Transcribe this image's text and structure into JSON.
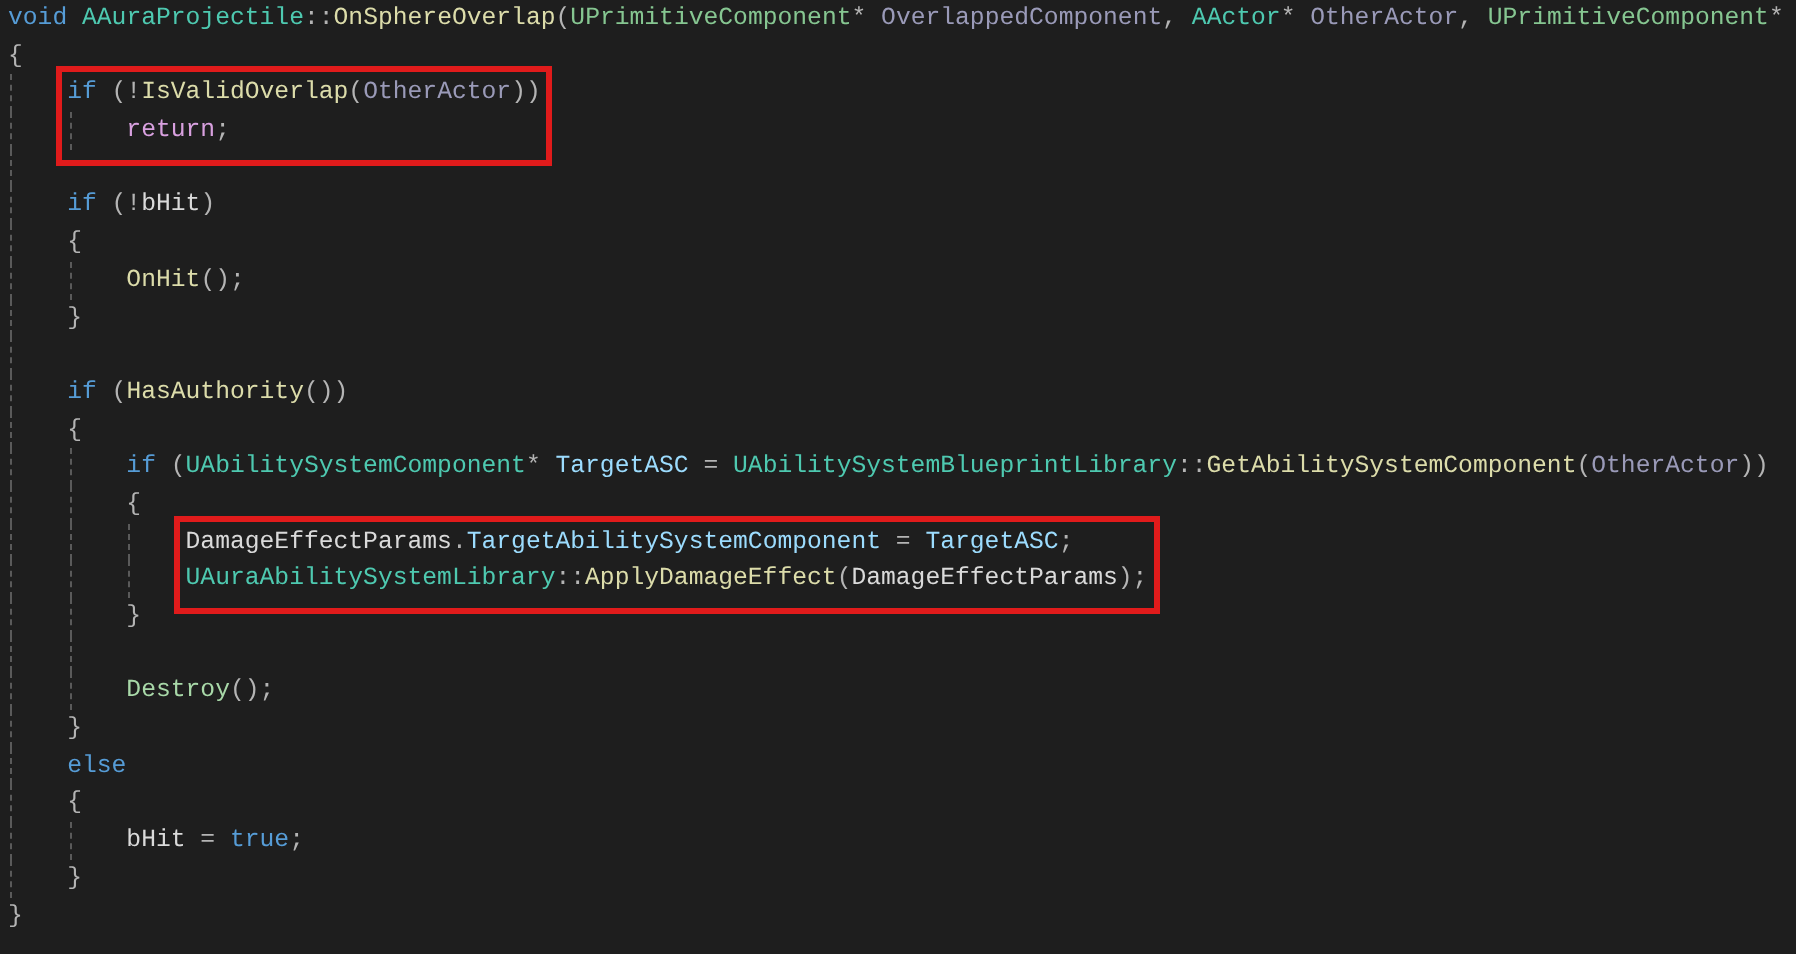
{
  "editor": {
    "blocks": [
      {
        "kind": "plain",
        "lines": [
          {
            "kind": "code",
            "tokens": [
              {
                "kind": "kw",
                "text": "void "
              },
              {
                "kind": "type",
                "text": "AAuraProjectile"
              },
              {
                "kind": "p",
                "text": "::"
              },
              {
                "kind": "fn",
                "text": "OnSphereOverlap"
              },
              {
                "kind": "p",
                "text": "("
              },
              {
                "kind": "struct",
                "text": "UPrimitiveComponent"
              },
              {
                "kind": "p",
                "text": "* "
              },
              {
                "kind": "param",
                "text": "OverlappedComponent"
              },
              {
                "kind": "p",
                "text": ", "
              },
              {
                "kind": "type",
                "text": "AActor"
              },
              {
                "kind": "p",
                "text": "* "
              },
              {
                "kind": "param",
                "text": "OtherActor"
              },
              {
                "kind": "p",
                "text": ", "
              },
              {
                "kind": "struct",
                "text": "UPrimitiveComponent"
              },
              {
                "kind": "p",
                "text": "*"
              }
            ]
          },
          {
            "kind": "code",
            "tokens": [
              {
                "kind": "p",
                "text": "{"
              }
            ]
          }
        ]
      },
      {
        "kind": "boxed",
        "lines": [
          {
            "kind": "code",
            "tokens": [
              {
                "kind": "kw",
                "text": "    if"
              },
              {
                "kind": "p",
                "text": " (!"
              },
              {
                "kind": "fn",
                "text": "IsValidOverlap"
              },
              {
                "kind": "p",
                "text": "("
              },
              {
                "kind": "param",
                "text": "OtherActor"
              },
              {
                "kind": "p",
                "text": "))"
              }
            ]
          },
          {
            "kind": "code",
            "tokens": [
              {
                "kind": "ctrl",
                "text": "        return"
              },
              {
                "kind": "p",
                "text": ";"
              }
            ]
          }
        ]
      },
      {
        "kind": "plain",
        "lines": [
          {
            "kind": "blank"
          },
          {
            "kind": "code",
            "tokens": [
              {
                "kind": "kw",
                "text": "    if"
              },
              {
                "kind": "p",
                "text": " (!"
              },
              {
                "kind": "var",
                "text": "bHit"
              },
              {
                "kind": "p",
                "text": ")"
              }
            ]
          },
          {
            "kind": "code",
            "tokens": [
              {
                "kind": "p",
                "text": "    {"
              }
            ]
          },
          {
            "kind": "code",
            "tokens": [
              {
                "kind": "fn",
                "text": "        OnHit"
              },
              {
                "kind": "p",
                "text": "();"
              }
            ]
          },
          {
            "kind": "code",
            "tokens": [
              {
                "kind": "p",
                "text": "    }"
              }
            ]
          },
          {
            "kind": "blank"
          },
          {
            "kind": "code",
            "tokens": [
              {
                "kind": "kw",
                "text": "    if"
              },
              {
                "kind": "p",
                "text": " ("
              },
              {
                "kind": "fn",
                "text": "HasAuthority"
              },
              {
                "kind": "p",
                "text": "())"
              }
            ]
          },
          {
            "kind": "code",
            "tokens": [
              {
                "kind": "p",
                "text": "    {"
              }
            ]
          },
          {
            "kind": "code",
            "tokens": [
              {
                "kind": "kw",
                "text": "        if"
              },
              {
                "kind": "p",
                "text": " ("
              },
              {
                "kind": "type",
                "text": "UAbilitySystemComponent"
              },
              {
                "kind": "p",
                "text": "* "
              },
              {
                "kind": "local",
                "text": "TargetASC"
              },
              {
                "kind": "p",
                "text": " = "
              },
              {
                "kind": "type",
                "text": "UAbilitySystemBlueprintLibrary"
              },
              {
                "kind": "p",
                "text": "::"
              },
              {
                "kind": "fn",
                "text": "GetAbilitySystemComponent"
              },
              {
                "kind": "p",
                "text": "("
              },
              {
                "kind": "param",
                "text": "OtherActor"
              },
              {
                "kind": "p",
                "text": "))"
              }
            ]
          },
          {
            "kind": "code",
            "tokens": [
              {
                "kind": "p",
                "text": "        {"
              }
            ]
          }
        ]
      },
      {
        "kind": "boxed",
        "lines": [
          {
            "kind": "code",
            "tokens": [
              {
                "kind": "var",
                "text": "            DamageEffectParams"
              },
              {
                "kind": "p",
                "text": "."
              },
              {
                "kind": "local",
                "text": "TargetAbilitySystemComponent"
              },
              {
                "kind": "p",
                "text": " = "
              },
              {
                "kind": "local",
                "text": "TargetASC"
              },
              {
                "kind": "p",
                "text": ";"
              }
            ]
          },
          {
            "kind": "code",
            "tokens": [
              {
                "kind": "type",
                "text": "            UAuraAbilitySystemLibrary"
              },
              {
                "kind": "p",
                "text": "::"
              },
              {
                "kind": "fn",
                "text": "ApplyDamageEffect"
              },
              {
                "kind": "p",
                "text": "("
              },
              {
                "kind": "var",
                "text": "DamageEffectParams"
              },
              {
                "kind": "p",
                "text": ");"
              }
            ]
          }
        ]
      },
      {
        "kind": "plain",
        "lines": [
          {
            "kind": "code",
            "tokens": [
              {
                "kind": "p",
                "text": "        }"
              }
            ]
          },
          {
            "kind": "blank"
          },
          {
            "kind": "code",
            "tokens": [
              {
                "kind": "ufn",
                "text": "        Destroy"
              },
              {
                "kind": "p",
                "text": "();"
              }
            ]
          },
          {
            "kind": "code",
            "tokens": [
              {
                "kind": "p",
                "text": "    }"
              }
            ]
          },
          {
            "kind": "code",
            "tokens": [
              {
                "kind": "kw",
                "text": "    else"
              }
            ]
          },
          {
            "kind": "code",
            "tokens": [
              {
                "kind": "p",
                "text": "    {"
              }
            ]
          },
          {
            "kind": "code",
            "tokens": [
              {
                "kind": "var",
                "text": "        bHit"
              },
              {
                "kind": "p",
                "text": " = "
              },
              {
                "kind": "kw",
                "text": "true"
              },
              {
                "kind": "p",
                "text": ";"
              }
            ]
          },
          {
            "kind": "code",
            "tokens": [
              {
                "kind": "p",
                "text": "    }"
              }
            ]
          },
          {
            "kind": "code",
            "tokens": [
              {
                "kind": "p",
                "text": "}"
              }
            ]
          }
        ]
      }
    ]
  }
}
